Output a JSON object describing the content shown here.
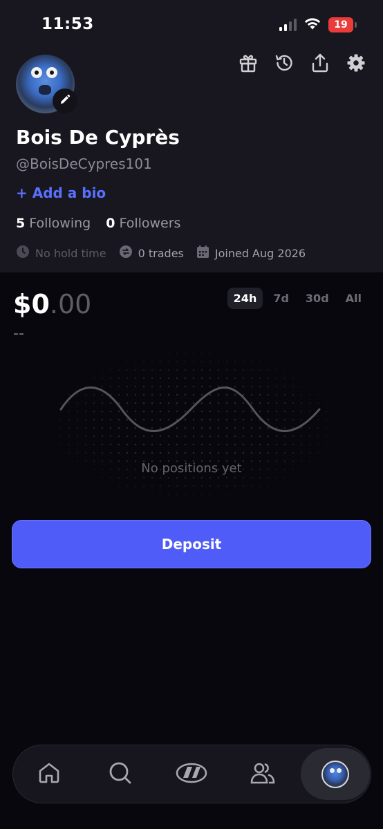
{
  "status_bar": {
    "time": "11:53",
    "battery_level": "19",
    "battery_color": "#eb3b3b"
  },
  "header": {
    "actions": [
      "gift-icon",
      "history-icon",
      "share-icon",
      "settings-icon"
    ]
  },
  "profile": {
    "name": "Bois De Cyprès",
    "handle": "@BoisDeCypres101",
    "add_bio_label": "+ Add a bio",
    "following_count": "5",
    "following_label": "Following",
    "followers_count": "0",
    "followers_label": "Followers",
    "hold_time": "No hold time",
    "trades": "0 trades",
    "joined": "Joined Aug 2026"
  },
  "portfolio": {
    "balance_whole": "$0",
    "balance_decimal": ".00",
    "change": "--",
    "ranges": [
      "24h",
      "7d",
      "30d",
      "All"
    ],
    "selected_range": "24h",
    "empty_message": "No positions yet"
  },
  "deposit_label": "Deposit",
  "colors": {
    "accent": "#4f5cf7",
    "link": "#5a70ff",
    "header_bg": "#18171f",
    "page_bg": "#08070e"
  },
  "bottom_nav": {
    "items": [
      "home-icon",
      "search-icon",
      "trade-icon",
      "people-icon",
      "profile-avatar"
    ],
    "active": "profile-avatar"
  }
}
